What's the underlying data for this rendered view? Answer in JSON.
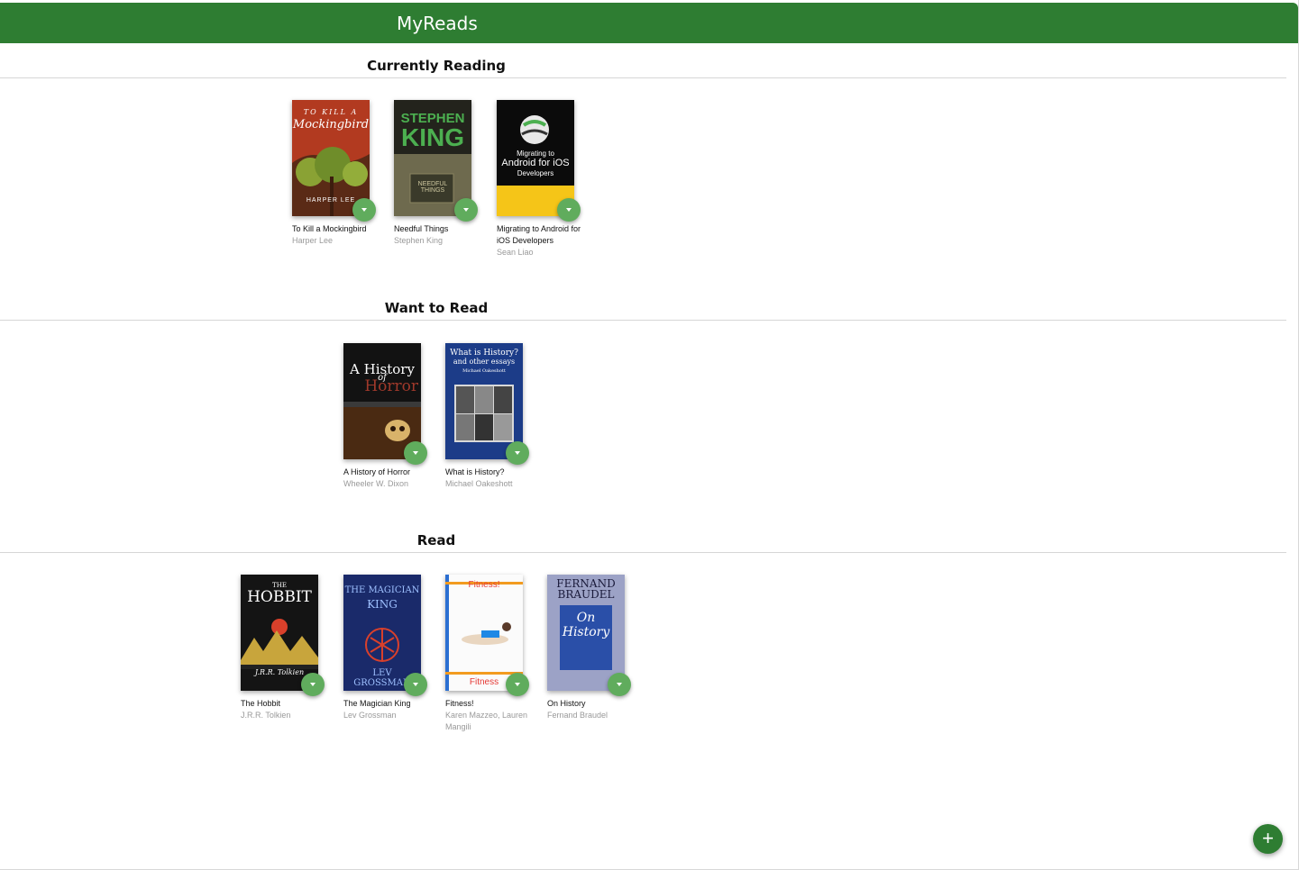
{
  "app": {
    "title": "MyReads"
  },
  "shelves": [
    {
      "title": "Currently Reading",
      "books": [
        {
          "title": "To Kill a Mockingbird",
          "authors": "Harper Lee",
          "cover_text": [
            "TO KILL A",
            "Mockingbird",
            "HARPER LEE"
          ]
        },
        {
          "title": "Needful Things",
          "authors": "Stephen King",
          "cover_text": [
            "STEPHEN",
            "KING",
            "NEEDFUL THINGS"
          ]
        },
        {
          "title": "Migrating to Android for iOS Developers",
          "authors": "Sean Liao",
          "cover_text": [
            "Migrating to",
            "Android for iOS",
            "Developers"
          ]
        }
      ]
    },
    {
      "title": "Want to Read",
      "books": [
        {
          "title": "A History of Horror",
          "authors": "Wheeler W. Dixon",
          "cover_text": [
            "A History",
            "of",
            "Horror"
          ]
        },
        {
          "title": "What is History?",
          "authors": "Michael Oakeshott",
          "cover_text": [
            "What is History?",
            "and other essays",
            "Michael Oakeshott"
          ]
        }
      ]
    },
    {
      "title": "Read",
      "books": [
        {
          "title": "The Hobbit",
          "authors": "J.R.R. Tolkien",
          "cover_text": [
            "THE",
            "HOBBIT",
            "J.R.R. Tolkien"
          ]
        },
        {
          "title": "The Magician King",
          "authors": "Lev Grossman",
          "cover_text": [
            "THE MAGICIAN",
            "KING",
            "LEV GROSSMAN"
          ]
        },
        {
          "title": "Fitness!",
          "authors": "Karen Mazzeo, Lauren Mangili",
          "cover_text": [
            "Fitness!",
            "Fitness"
          ]
        },
        {
          "title": "On History",
          "authors": "Fernand Braudel",
          "cover_text": [
            "FERNAND",
            "BRAUDEL",
            "On",
            "History"
          ]
        }
      ]
    }
  ],
  "fab": {
    "icon": "plus-icon",
    "symbol": "+"
  },
  "colors": {
    "header": "#2e7d32",
    "changer": "#60ac5d",
    "fab": "#2e7d32"
  }
}
